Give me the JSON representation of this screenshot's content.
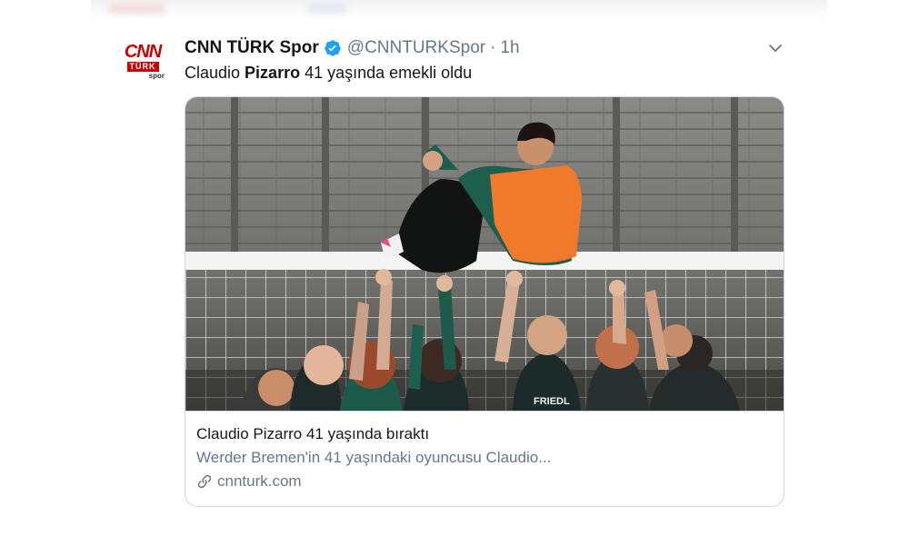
{
  "tweet": {
    "author_name": "CNN TÜRK Spor",
    "handle": "@CNNTURKSpor",
    "separator": "·",
    "time": "1h",
    "text_pre": "Claudio ",
    "text_bold": "Pizarro",
    "text_post": " 41 yaşında emekli oldu"
  },
  "avatar": {
    "logo_cnn": "CNN",
    "logo_turk": "TÜRK",
    "logo_spor": "spor"
  },
  "card": {
    "title": "Claudio Pizarro 41 yaşında bıraktı",
    "description": "Werder Bremen'in 41 yaşındaki oyuncusu Claudio...",
    "domain": "cnnturk.com",
    "jersey_text": "FRIEDL"
  },
  "icons": {
    "verified": "verified-badge-icon",
    "chevron": "chevron-down-icon",
    "link": "link-icon"
  },
  "colors": {
    "verified_blue": "#1da1f2",
    "secondary_text": "#657786",
    "border": "#ccd6dd",
    "brand_red": "#cc0000",
    "vest_orange": "#f07a2a"
  }
}
